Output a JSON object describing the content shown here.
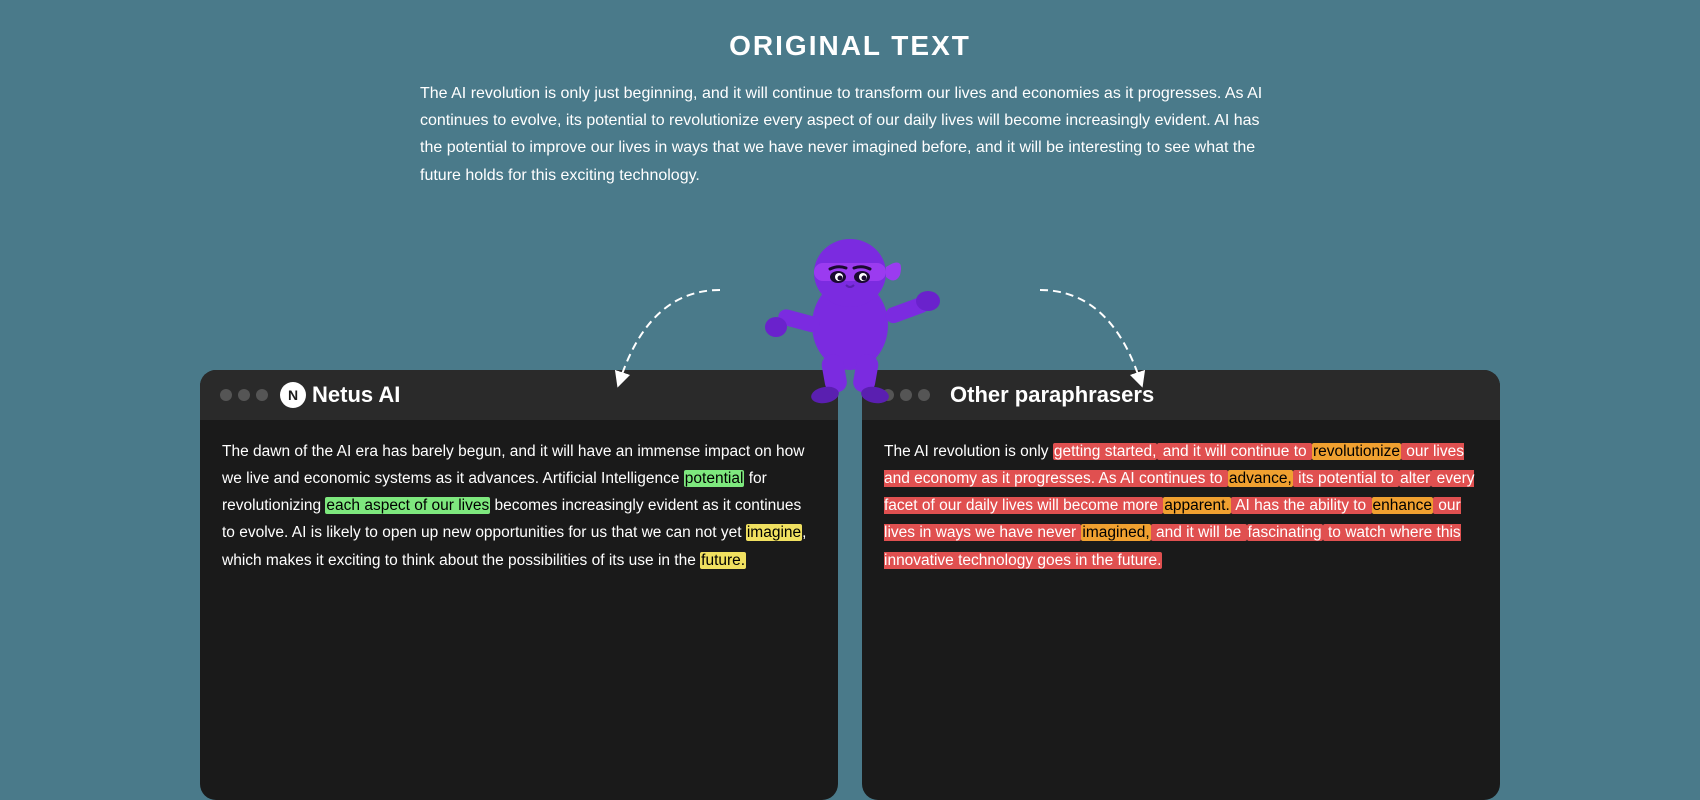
{
  "page": {
    "background_color": "#4a7a8a"
  },
  "original_text": {
    "title": "ORIGINAL TEXT",
    "body": "The AI revolution is only just beginning, and it will continue to transform our lives and economies as it progresses. As AI continues to evolve, its potential to revolutionize every aspect of our daily lives will become increasingly evident. AI has the potential to improve our lives in ways that we have never imagined before, and it will be interesting to see what the future holds for this exciting technology."
  },
  "netus_box": {
    "title": "Netus AI",
    "dots": [
      "dot1",
      "dot2",
      "dot3"
    ],
    "content_segments": [
      {
        "text": "The dawn of the AI era has barely begun, and it will have an immense impact on how we live and economic systems as it advances. Artificial Intelligence ",
        "highlight": null
      },
      {
        "text": "potential",
        "highlight": "yellow"
      },
      {
        "text": " for revolutionizing ",
        "highlight": null
      },
      {
        "text": "each aspect of our lives",
        "highlight": "green"
      },
      {
        "text": " becomes increasingly evident as it continues to evolve. AI is likely to open up new opportunities for us that we can not yet ",
        "highlight": null
      },
      {
        "text": "imagine",
        "highlight": "yellow"
      },
      {
        "text": ", which makes it exciting to think about the possibilities of its use in the ",
        "highlight": null
      },
      {
        "text": "future.",
        "highlight": "yellow"
      }
    ]
  },
  "other_box": {
    "title": "Other paraphrasers",
    "dots": [
      "dot1",
      "dot2",
      "dot3"
    ],
    "content_segments": [
      {
        "text": "The AI revolution is only ",
        "highlight": null
      },
      {
        "text": "getting started,",
        "highlight": "red"
      },
      {
        "text": " and it will continue to ",
        "highlight": "red"
      },
      {
        "text": "revolutionize",
        "highlight": "orange"
      },
      {
        "text": " our lives and economy as it progresses. As AI continues to ",
        "highlight": "red"
      },
      {
        "text": "advance,",
        "highlight": "orange"
      },
      {
        "text": " its potential to ",
        "highlight": "red"
      },
      {
        "text": "alter",
        "highlight": "red"
      },
      {
        "text": " every facet of our daily lives will become more ",
        "highlight": "red"
      },
      {
        "text": "apparent.",
        "highlight": "orange"
      },
      {
        "text": " AI has the ability to ",
        "highlight": "red"
      },
      {
        "text": "enhance",
        "highlight": "orange"
      },
      {
        "text": " our lives in ways we have never ",
        "highlight": "red"
      },
      {
        "text": "imagined,",
        "highlight": "orange"
      },
      {
        "text": " and it will be ",
        "highlight": "red"
      },
      {
        "text": "fascinating",
        "highlight": "red"
      },
      {
        "text": " to watch where this innovative technology goes in the future.",
        "highlight": "red"
      }
    ]
  }
}
